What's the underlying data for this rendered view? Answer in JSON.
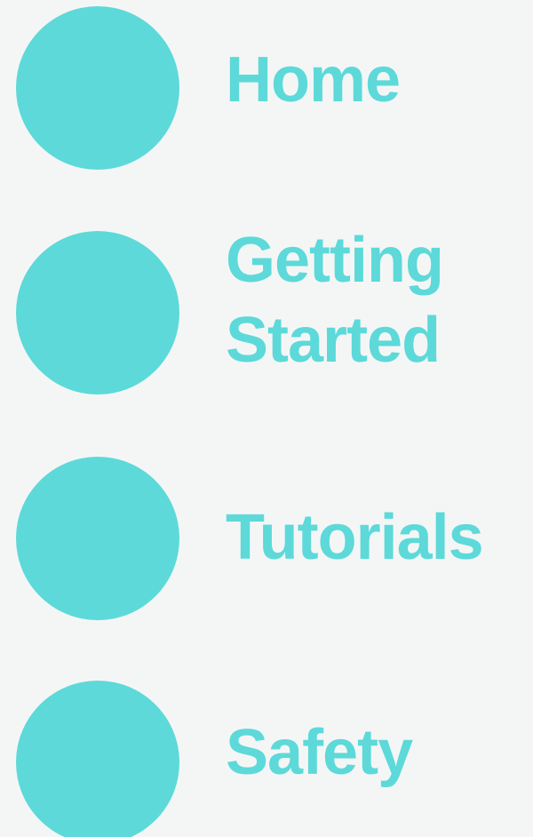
{
  "colors": {
    "background": "#f4f6f6",
    "accent": "#5dd9d9"
  },
  "nav": {
    "items": [
      {
        "label": "Home",
        "icon": "circle-icon"
      },
      {
        "label": "Getting Started",
        "icon": "circle-icon"
      },
      {
        "label": "Tutorials",
        "icon": "circle-icon"
      },
      {
        "label": "Safety",
        "icon": "circle-icon"
      }
    ]
  }
}
